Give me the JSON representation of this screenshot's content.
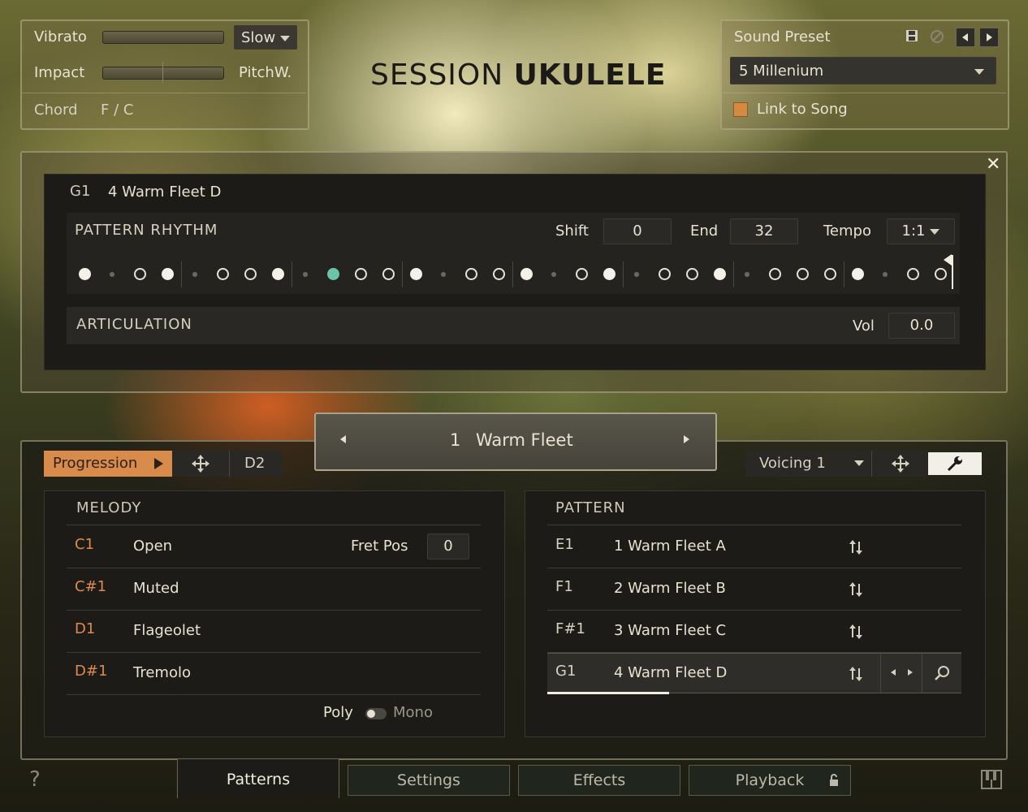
{
  "title": {
    "light": "SESSION ",
    "bold": "UKULELE"
  },
  "top_left": {
    "vibrato_label": "Vibrato",
    "vibrato_mode": "Slow",
    "impact_label": "Impact",
    "pitchw_label": "PitchW.",
    "chord_label": "Chord",
    "chord_value": "F / C"
  },
  "top_right": {
    "sound_preset_label": "Sound Preset",
    "preset_value": "5  Millenium",
    "link_label": "Link to Song"
  },
  "editor": {
    "key": "G1",
    "pattern_name": "4  Warm Fleet D",
    "rhythm_label": "PATTERN RHYTHM",
    "shift_label": "Shift",
    "shift_value": "0",
    "end_label": "End",
    "end_value": "32",
    "tempo_label": "Tempo",
    "tempo_value": "1:1",
    "articulation_label": "ARTICULATION",
    "vol_label": "Vol",
    "vol_value": "0.0",
    "steps": [
      "filled",
      "small",
      "open",
      "filled",
      "small",
      "open",
      "open",
      "filled",
      "small",
      "accent",
      "open",
      "open",
      "filled",
      "small",
      "open",
      "open",
      "filled",
      "small",
      "open",
      "filled",
      "small",
      "open",
      "open",
      "filled",
      "small",
      "open",
      "open",
      "open",
      "filled",
      "small",
      "open",
      "open"
    ]
  },
  "selector": {
    "number": "1",
    "name": "Warm Fleet"
  },
  "toolbar": {
    "progression_label": "Progression",
    "d2_label": "D2",
    "voicing_label": "Voicing 1"
  },
  "melody": {
    "header": "MELODY",
    "fret_pos_label": "Fret Pos",
    "fret_pos_value": "0",
    "rows": [
      {
        "key": "C1",
        "name": "Open"
      },
      {
        "key": "C#1",
        "name": "Muted"
      },
      {
        "key": "D1",
        "name": "Flageolet"
      },
      {
        "key": "D#1",
        "name": "Tremolo"
      }
    ],
    "poly_label": "Poly",
    "mono_label": "Mono"
  },
  "pattern": {
    "header": "PATTERN",
    "rows": [
      {
        "key": "E1",
        "name": "1  Warm Fleet A"
      },
      {
        "key": "F1",
        "name": "2  Warm Fleet B"
      },
      {
        "key": "F#1",
        "name": "3  Warm Fleet C"
      },
      {
        "key": "G1",
        "name": "4  Warm Fleet D"
      }
    ]
  },
  "tabs": [
    "Patterns",
    "Settings",
    "Effects",
    "Playback"
  ],
  "help_label": "?",
  "colors": {
    "accent_orange": "#dc8a4e",
    "step_accent": "#6dc3a9"
  }
}
